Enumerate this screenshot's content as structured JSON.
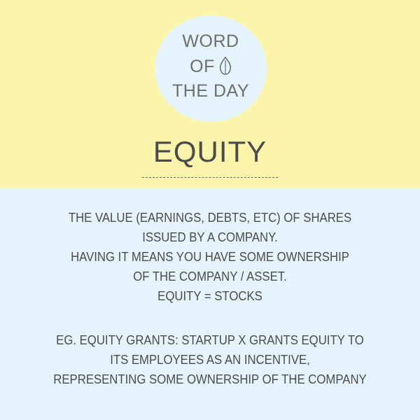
{
  "badge": {
    "lines": [
      "WORD",
      "OF",
      "THE DAY"
    ],
    "icon": "leaf-icon"
  },
  "word": "EQUITY",
  "definition_lines": [
    "THE VALUE (EARNINGS, DEBTS, ETC) OF SHARES",
    "ISSUED BY A COMPANY.",
    "HAVING IT MEANS YOU HAVE SOME OWNERSHIP",
    "OF THE COMPANY / ASSET.",
    "EQUITY = STOCKS"
  ],
  "example_lines": [
    "EG. EQUITY GRANTS: STARTUP X GRANTS EQUITY TO",
    "ITS EMPLOYEES AS AN INCENTIVE,",
    "REPRESENTING SOME OWNERSHIP OF THE COMPANY"
  ],
  "colors": {
    "top_background": "#faf5aa",
    "bottom_background": "#e5f3fc",
    "badge_background": "#e5f3fc",
    "text": "#4b4b4b"
  }
}
